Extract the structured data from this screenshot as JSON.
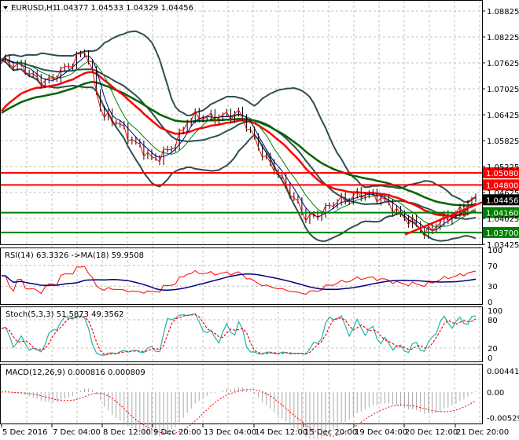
{
  "header": {
    "symbol": "EURUSD,H1",
    "ohlc": "1.04377 1.04533 1.04329 1.04456"
  },
  "price_axis": [
    "1.08825",
    "1.08225",
    "1.07625",
    "1.07025",
    "1.06425",
    "1.05825",
    "1.05225",
    "1.04625",
    "1.04025",
    "1.03425"
  ],
  "levels": [
    {
      "label": "1.05080",
      "value": 1.0508,
      "color": "#ff0000"
    },
    {
      "label": "1.04800",
      "value": 1.048,
      "color": "#ff0000"
    },
    {
      "label": "1.04160",
      "value": 1.0416,
      "color": "#008000"
    },
    {
      "label": "1.03700",
      "value": 1.037,
      "color": "#008000"
    }
  ],
  "current_price": {
    "label": "1.04456",
    "value": 1.04456
  },
  "rsi": {
    "title": "RSI(14) 63.3326  ->MA(18) 59.9508",
    "axis": [
      "100",
      "70",
      "30",
      "0"
    ]
  },
  "stoch": {
    "title": "Stoch(5,3,3) 51.5873 49.3562",
    "axis": [
      "100",
      "80",
      "20",
      "0"
    ]
  },
  "macd": {
    "title": "MACD(12,26,9) 0.000816 0.000809",
    "axis": [
      "0.004414",
      "0.00",
      "-0.005299"
    ]
  },
  "time_axis": [
    "5 Dec 2016",
    "7 Dec 04:00",
    "8 Dec 12:00",
    "9 Dec 20:00",
    "13 Dec 04:00",
    "14 Dec 12:00",
    "15 Dec 20:00",
    "19 Dec 04:00",
    "20 Dec 12:00",
    "21 Dec 20:00"
  ],
  "chart_data": {
    "type": "line",
    "title": "EURUSD,H1",
    "anchor_closes": [
      1.0765,
      1.076,
      1.0725,
      1.0722,
      1.076,
      1.079,
      1.064,
      1.062,
      1.057,
      1.054,
      1.056,
      1.063,
      1.064,
      1.0635,
      1.065,
      1.058,
      1.052,
      1.047,
      1.04,
      1.042,
      1.0445,
      1.0455,
      1.046,
      1.043,
      1.04,
      1.037,
      1.0395,
      1.042,
      1.0446
    ],
    "ylim": [
      1.03425,
      1.08825
    ],
    "trendline": [
      1.0365,
      1.044
    ]
  },
  "colors": {
    "bull": "#000000",
    "band": "#2f4f4f",
    "ma_fast": "#00008b",
    "ma_mid": "#008000",
    "ema_long": "#ff0000",
    "ema_longer": "#006400",
    "rsi": "#ff0000",
    "rsi_ma": "#000080",
    "stoch_main": "#20b2aa",
    "stoch_signal": "#ff0000",
    "macd_hist": "#a9a9a9",
    "macd_signal": "#ff0000"
  }
}
